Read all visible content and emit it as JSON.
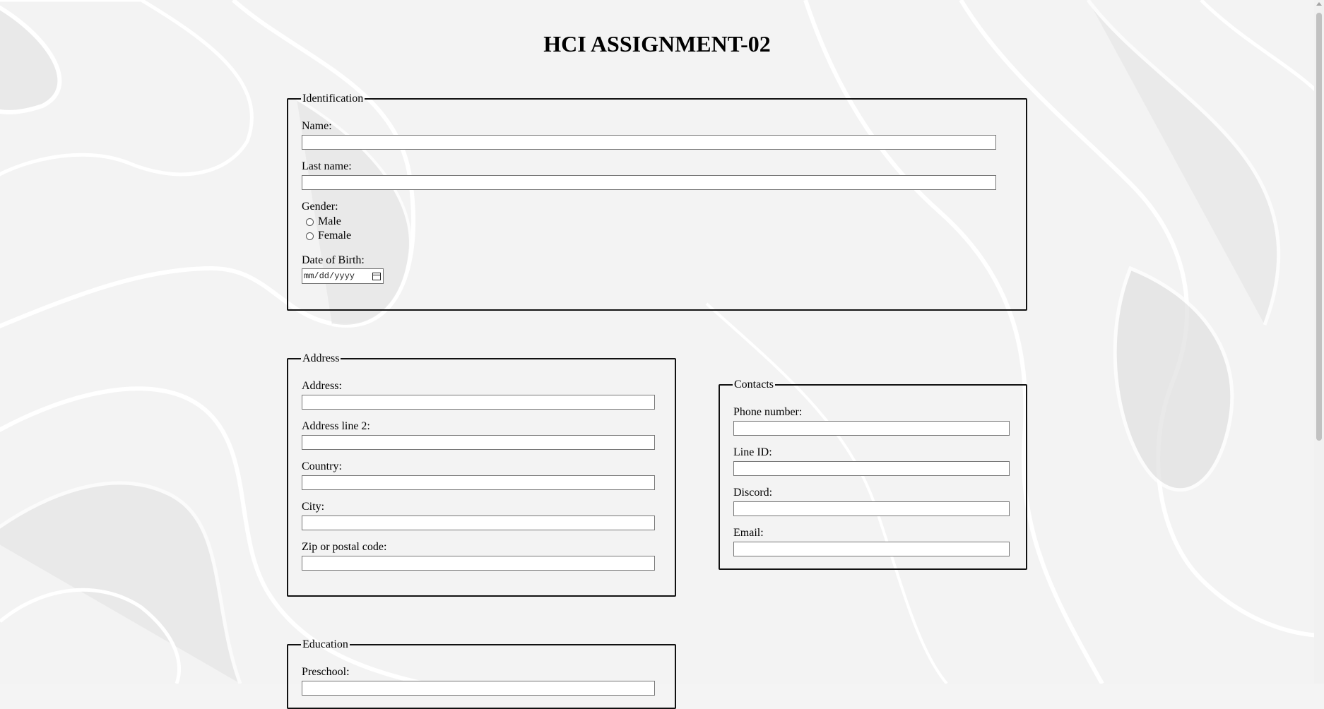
{
  "title": "HCI ASSIGNMENT-02",
  "identification": {
    "legend": "Identification",
    "name_label": "Name:",
    "lastname_label": "Last name:",
    "gender_label": "Gender:",
    "gender_options": [
      "Male",
      "Female"
    ],
    "dob_label": "Date of Birth:",
    "dob_placeholder": "mm/dd/yyyy"
  },
  "address": {
    "legend": "Address",
    "address_label": "Address:",
    "address2_label": "Address line 2:",
    "country_label": "Country:",
    "city_label": "City:",
    "zip_label": "Zip or postal code:"
  },
  "contacts": {
    "legend": "Contacts",
    "phone_label": "Phone number:",
    "line_label": "Line ID:",
    "discord_label": "Discord:",
    "email_label": "Email:"
  },
  "education": {
    "legend": "Education",
    "preschool_label": "Preschool:"
  },
  "icons": {
    "calendar": "calendar-icon",
    "scroll_up": "scroll-up-arrow-icon"
  }
}
